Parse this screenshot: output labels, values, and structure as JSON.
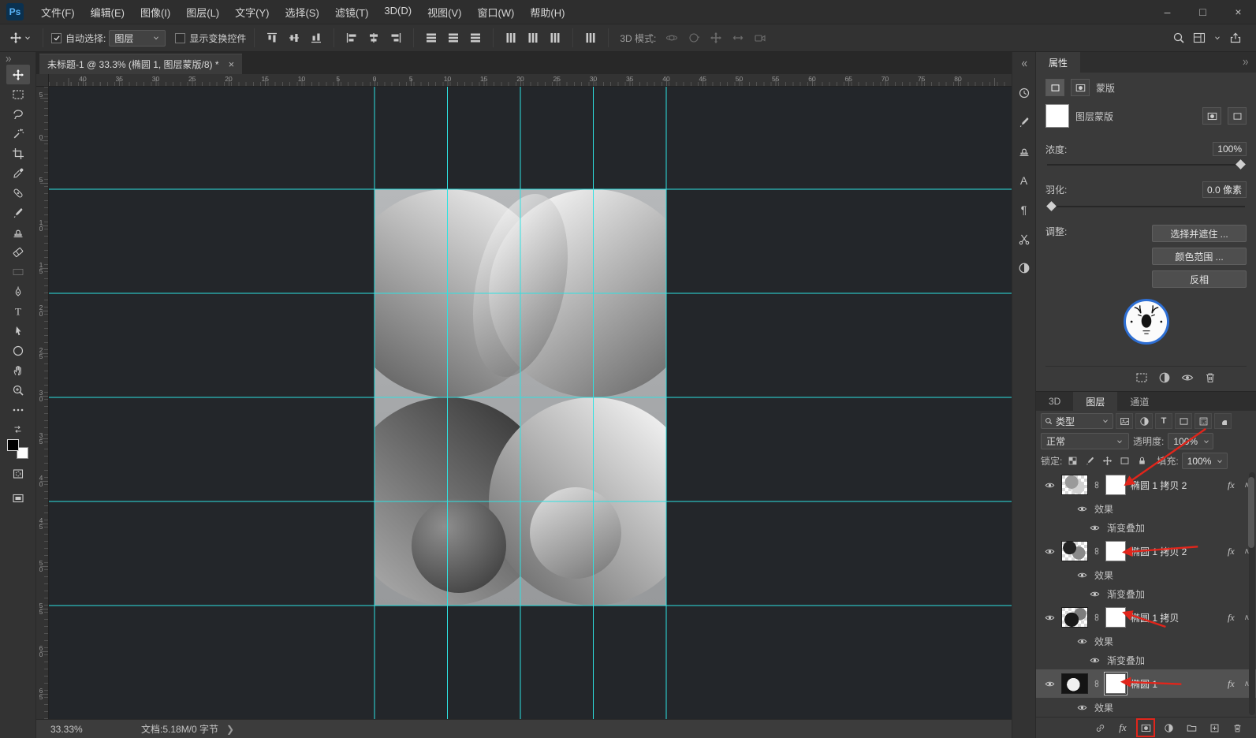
{
  "app": {
    "logo": "Ps"
  },
  "menu": {
    "items": [
      "文件(F)",
      "编辑(E)",
      "图像(I)",
      "图层(L)",
      "文字(Y)",
      "选择(S)",
      "滤镜(T)",
      "3D(D)",
      "视图(V)",
      "窗口(W)",
      "帮助(H)"
    ]
  },
  "window_controls": {
    "minimize": "–",
    "maximize": "□",
    "close": "×"
  },
  "options": {
    "auto_select_label": "自动选择:",
    "auto_select_value": "图层",
    "show_transform_label": "显示变换控件",
    "mode_label": "3D 模式:"
  },
  "doc_tab": {
    "title": "未标题-1 @ 33.3% (椭圆 1, 图层蒙版/8) *",
    "close": "×"
  },
  "rulers": {
    "top": [
      "40",
      "35",
      "30",
      "25",
      "20",
      "15",
      "10",
      "5",
      "0",
      "5",
      "10",
      "15",
      "20",
      "25",
      "30",
      "35",
      "40",
      "45",
      "50",
      "55",
      "60",
      "65",
      "70",
      "75",
      "80"
    ],
    "left": [
      "5",
      "0",
      "5",
      "1\n0",
      "1\n5",
      "2\n0",
      "2\n5",
      "3\n0",
      "3\n5",
      "4\n0",
      "4\n5",
      "5\n0",
      "5\n5",
      "6\n0",
      "6\n5"
    ]
  },
  "status": {
    "zoom": "33.33%",
    "doc_info": "文档:5.18M/0 字节"
  },
  "properties": {
    "tab": "属性",
    "masks_title": "蒙版",
    "layer_mask_label": "图层蒙版",
    "density_label": "浓度:",
    "density_value": "100%",
    "feather_label": "羽化:",
    "feather_value": "0.0 像素",
    "adjust_label": "调整:",
    "select_and_mask_button": "选择并遮住 ...",
    "color_range_button": "颜色范围 ...",
    "invert_button": "反相"
  },
  "layers": {
    "tabs": [
      "3D",
      "图层",
      "通道"
    ],
    "filter_label": "类型",
    "blend_mode": "正常",
    "opacity_label": "透明度:",
    "opacity_value": "100%",
    "lock_label": "锁定:",
    "fill_label": "填充:",
    "fill_value": "100%",
    "fx": "fx",
    "effects_label": "效果",
    "gradient_overlay_label": "渐变叠加",
    "items": [
      {
        "name": "椭圆 1 拷贝 2"
      },
      {
        "name": "椭圆 1 拷贝 2"
      },
      {
        "name": "椭圆 1 拷贝"
      },
      {
        "name": "椭圆 1"
      }
    ]
  },
  "colors": {
    "guide": "#2ee2e2",
    "annotation": "#e1251b",
    "accent_blue": "#31a8ff"
  }
}
